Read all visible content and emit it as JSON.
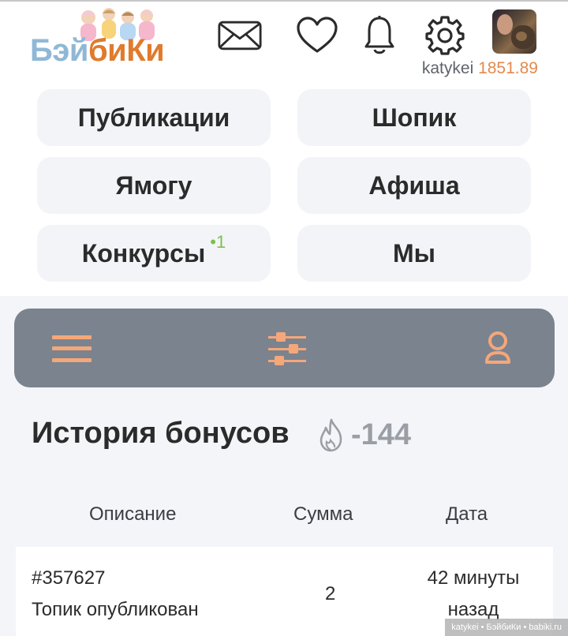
{
  "logo": {
    "part1": "Бэй",
    "part2": "биКи"
  },
  "user": {
    "name": "katykei",
    "balance": "1851.89"
  },
  "nav": {
    "publications": "Публикации",
    "shop": "Шопик",
    "yamogu": "Ямогу",
    "afisha": "Афиша",
    "contests": "Конкурсы",
    "contests_badge": "•1",
    "we": "Мы"
  },
  "page": {
    "title": "История бонусов",
    "total": "-144"
  },
  "table": {
    "headers": [
      "Описание",
      "Сумма",
      "Дата"
    ],
    "rows": [
      {
        "id": "#357627",
        "desc": "Топик опубликован",
        "sum": "2",
        "date1": "42 минуты",
        "date2": "назад"
      }
    ]
  },
  "watermark": "katykei • БэйбиКи • babiki.ru",
  "colors": {
    "accent": "#e38a4c",
    "toolbar": "#7b838e",
    "badge": "#7cc04a",
    "toolbar_icon": "#f4a77a"
  }
}
